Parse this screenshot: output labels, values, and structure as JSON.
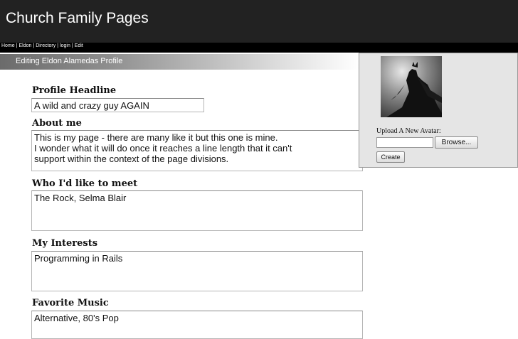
{
  "site": {
    "title": "Church Family Pages"
  },
  "nav": {
    "items": [
      {
        "label": "Home"
      },
      {
        "label": "Eldon"
      },
      {
        "label": "Directory"
      },
      {
        "label": "login"
      },
      {
        "label": "Edit"
      }
    ],
    "separator": "|"
  },
  "banner": {
    "text": "Editing Eldon Alamedas Profile"
  },
  "form": {
    "headline": {
      "label": "Profile Headline",
      "value": "A wild and crazy guy AGAIN"
    },
    "about": {
      "label": "About me",
      "lines": [
        "This is my page - there are many like it but this one is mine.",
        "I wonder what it will do once it reaches a line length that it can't",
        "support within the context of the page divisions."
      ]
    },
    "meet": {
      "label": "Who I'd like to meet",
      "value": "The Rock, Selma Blair"
    },
    "interests": {
      "label": "My Interests",
      "value": "Programming in Rails"
    },
    "music": {
      "label": "Favorite Music",
      "value": "Alternative, 80's Pop"
    }
  },
  "avatar": {
    "image": "superhero-avatar",
    "upload_label": "Upload A New Avatar:",
    "file_value": "",
    "browse_label": "Browse...",
    "create_label": "Create"
  },
  "colors": {
    "header_bg": "#222222",
    "nav_bg": "#000000",
    "panel_bg": "#e5e5e5"
  }
}
